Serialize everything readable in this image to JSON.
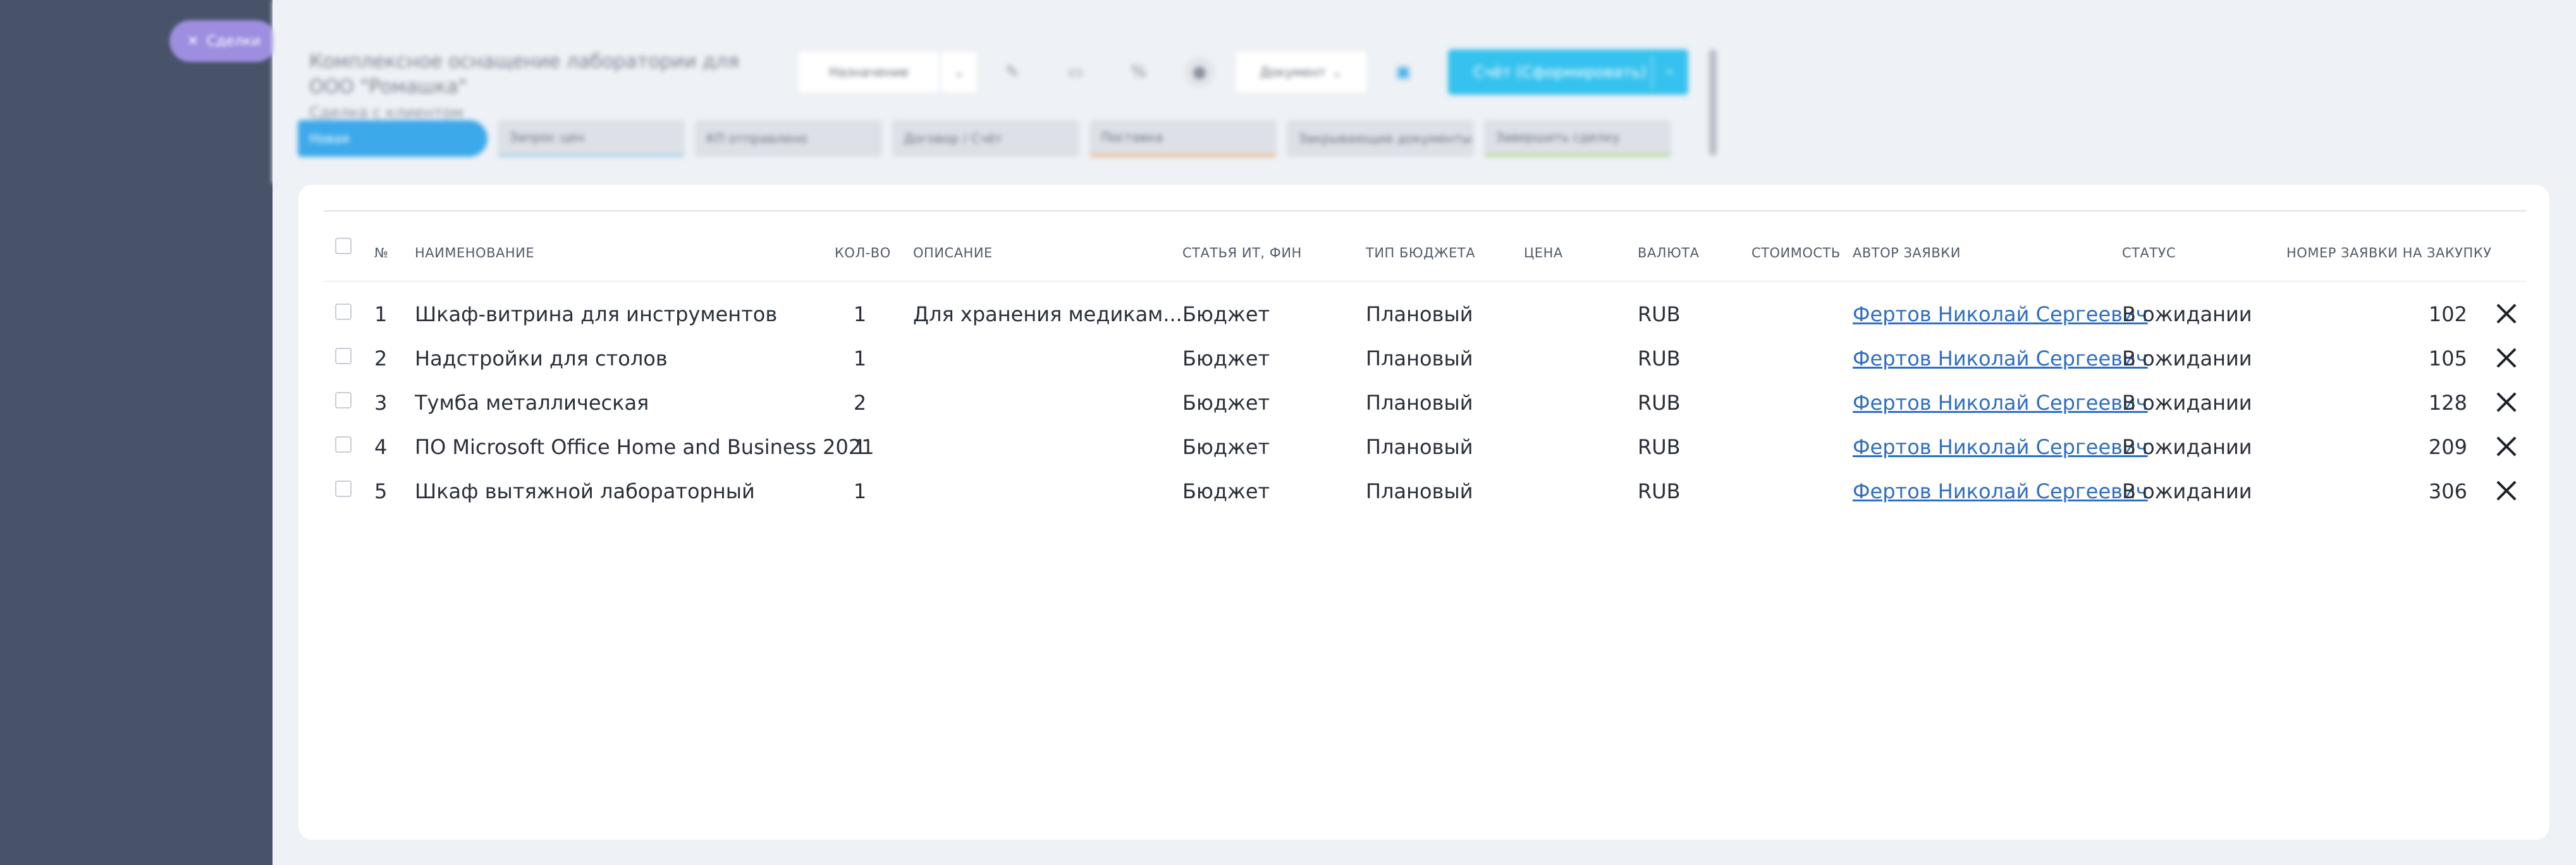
{
  "deal_pill": {
    "icon": "close-icon",
    "label": "Сделки"
  },
  "header": {
    "title": "Комплексное оснащение лаборатории для ООО \"Ромашка\"",
    "subtitle": "Сделка с клиентом",
    "toolbar": {
      "select_value": "Назначение",
      "document_label": "Документ",
      "cta_label": "Счёт (Сформировать)",
      "icons": [
        "pencil-icon",
        "comment-icon",
        "percent-icon",
        "record-icon",
        "clipboard-icon"
      ]
    },
    "stages": [
      "Новая",
      "Запрос цен",
      "КП отправлено",
      "Договор / Счёт",
      "Поставка",
      "Закрывающие документы",
      "Завершить сделку"
    ],
    "stage_colors": [
      "#3ca9ea",
      "#dde1e7",
      "#dde1e7",
      "#dde1e7",
      "#f0b27a",
      "#dde1e7",
      "#a7d987"
    ]
  },
  "table": {
    "headers": {
      "num": "№",
      "name": "НАИМЕНОВАНИЕ",
      "qty": "КОЛ-ВО",
      "desc": "ОПИСАНИЕ",
      "article": "СТАТЬЯ ИТ, ФИН",
      "budget_type": "ТИП БЮДЖЕТА",
      "price": "ЦЕНА",
      "currency": "ВАЛЮТА",
      "cost": "СТОИМОСТЬ",
      "author": "АВТОР ЗАЯВКИ",
      "status": "СТАТУС",
      "purchase_no": "НОМЕР ЗАЯВКИ НА ЗАКУПКУ"
    },
    "rows": [
      {
        "num": "1",
        "name": "Шкаф-витрина для инструментов",
        "qty": "1",
        "desc": "Для хранения медикам...",
        "article": "Бюджет",
        "budget_type": "Плановый",
        "price": "",
        "currency": "RUB",
        "cost": "",
        "author": "Фертов Николай Сергеевич",
        "status": "В ожидании",
        "purchase_no": "102"
      },
      {
        "num": "2",
        "name": "Надстройки для столов",
        "qty": "1",
        "desc": "",
        "article": "Бюджет",
        "budget_type": "Плановый",
        "price": "",
        "currency": "RUB",
        "cost": "",
        "author": "Фертов Николай Сергеевич",
        "status": "В ожидании",
        "purchase_no": "105"
      },
      {
        "num": "3",
        "name": "Тумба металлическая",
        "qty": "2",
        "desc": "",
        "article": "Бюджет",
        "budget_type": "Плановый",
        "price": "",
        "currency": "RUB",
        "cost": "",
        "author": "Фертов Николай Сергеевич",
        "status": "В ожидании",
        "purchase_no": "128"
      },
      {
        "num": "4",
        "name": "ПО Microsoft Office Home and Business 2021",
        "qty": "1",
        "desc": "",
        "article": "Бюджет",
        "budget_type": "Плановый",
        "price": "",
        "currency": "RUB",
        "cost": "",
        "author": "Фертов Николай Сергеевич",
        "status": "В ожидании",
        "purchase_no": "209"
      },
      {
        "num": "5",
        "name": "Шкаф вытяжной лабораторный",
        "qty": "1",
        "desc": "",
        "article": "Бюджет",
        "budget_type": "Плановый",
        "price": "",
        "currency": "RUB",
        "cost": "",
        "author": "Фертов Николай Сергеевич",
        "status": "В ожидании",
        "purchase_no": "306"
      }
    ],
    "row_action_icon": "close-icon"
  }
}
